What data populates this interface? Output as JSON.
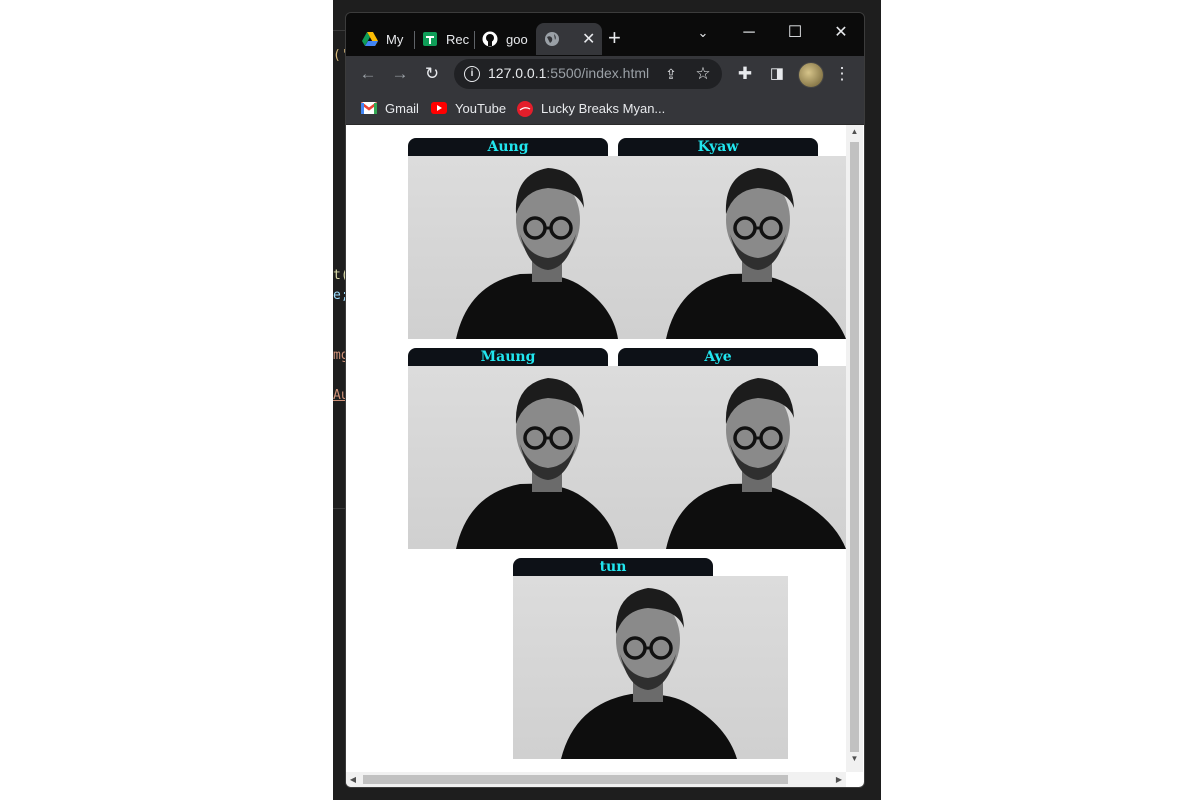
{
  "editor": {
    "fragments": [
      "('",
      "t(",
      "e;",
      "mg",
      "Au"
    ],
    "fragment_colors": [
      "#d7ba7d",
      "#dcdcaa",
      "#9cdcfe",
      "#ce9178",
      "#ce9178"
    ]
  },
  "browser": {
    "tabs": [
      {
        "label": "My",
        "icon": "google-drive-icon"
      },
      {
        "label": "Rec",
        "icon": "google-sheets-icon"
      },
      {
        "label": "goo",
        "icon": "github-icon"
      },
      {
        "label": "",
        "icon": "globe-icon",
        "active": true
      }
    ],
    "url_host": "127.0.0.1",
    "url_rest": ":5500/index.html",
    "bookmarks": [
      {
        "label": "Gmail",
        "icon": "gmail-icon"
      },
      {
        "label": "YouTube",
        "icon": "youtube-icon"
      },
      {
        "label": "Lucky Breaks Myan...",
        "icon": "coca-cola-icon"
      }
    ]
  },
  "page": {
    "cards": [
      {
        "name": "Aung"
      },
      {
        "name": "Kyaw"
      },
      {
        "name": "Maung"
      },
      {
        "name": "Aye"
      },
      {
        "name": "tun"
      }
    ]
  },
  "colors": {
    "label_bg": "#0d1117",
    "label_text": "#21e6ef"
  }
}
